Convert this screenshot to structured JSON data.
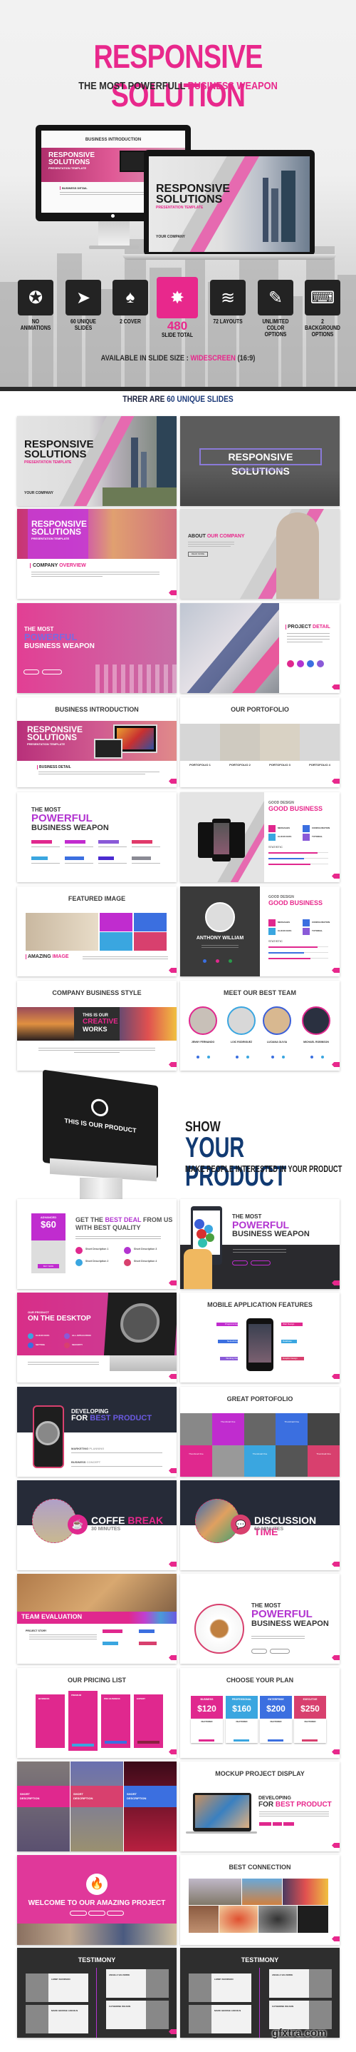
{
  "hero": {
    "title": "RESPONSIVE SOLUTION",
    "subtitle_dark": "THE MOST POWERFULL ",
    "subtitle_pink": "BUSINESS WEAPON",
    "back_monitor": {
      "heading": "BUSINESS INTRODUCTION",
      "title_line1": "RESPONSIVE",
      "title_line2": "SOLUTIONS",
      "tagline": "PRESENTATION TEMPLATE",
      "detail": "BUSINESS DETAIL"
    },
    "laptop": {
      "title_line1": "RESPONSIVE",
      "title_line2": "SOLUTIONS",
      "tagline": "PRESENTATION TEMPLATE",
      "company": "YOUR COMPANY"
    },
    "features": [
      {
        "icon": "lifebuoy-icon",
        "glyph": "✪",
        "label": "NO ANIMATIONS"
      },
      {
        "icon": "paper-plane-icon",
        "glyph": "➤",
        "label": "60 UNIQUE SLIDES"
      },
      {
        "icon": "card-icon",
        "glyph": "♠",
        "label": "2 COVER"
      },
      {
        "icon": "splash-icon",
        "glyph": "✸",
        "number": "480",
        "label": "SLIDE TOTAL",
        "active": true
      },
      {
        "icon": "layers-icon",
        "glyph": "≋",
        "label": "72 LAYOUTS"
      },
      {
        "icon": "eyedropper-icon",
        "glyph": "✎",
        "label": "UNLIMITED COLOR OPTIONS"
      },
      {
        "icon": "laptop-icon",
        "glyph": "⌨",
        "label": "2 BACKGROUND OPTIONS"
      }
    ],
    "availability_prefix": "AVAILABLE IN SLIDE  SIZE : ",
    "availability_highlight": "WIDESCREEN",
    "availability_suffix": " (16:9)"
  },
  "section_heading": {
    "prefix": "THRER ARE ",
    "highlight": "60 UNIQUE SLIDES"
  },
  "slides": {
    "s1": {
      "title1": "RESPONSIVE",
      "title2": "SOLUTIONS",
      "tagline": "PRESENTATION TEMPLATE",
      "company": "YOUR COMPANY"
    },
    "s2": {
      "title": "RESPONSIVE SOLUTIONS",
      "tagline": "PRESENTATION TEMPLATE"
    },
    "s3": {
      "title1": "RESPONSIVE",
      "title2": "SOLUTIONS",
      "tagline": "PRESENTATION TEMPLATE",
      "section_dark": "COMPANY ",
      "section_pink": "OVERVIEW"
    },
    "s4": {
      "title_dark": "ABOUT ",
      "title_pink": "OUR COMPANY",
      "button": "READ MORE"
    },
    "s5": {
      "line1": "THE MOST",
      "line2": "POWERFUL",
      "line3": "BUSINESS WEAPON"
    },
    "s6": {
      "title_dark": "PROJECT ",
      "title_pink": "DETAIL"
    },
    "s7": {
      "heading": "BUSINESS INTRODUCTION",
      "title1": "RESPONSIVE",
      "title2": "SOLUTIONS",
      "tagline": "PRESENTATION TEMPLATE",
      "detail": "BUSINESS DETAIL"
    },
    "s8": {
      "heading": "OUR PORTOFOLIO",
      "items": [
        "PORTOFOLIO 1",
        "PORTOFOLIO 2",
        "PORTOFOLIO 3",
        "PORTOFOLIO 4"
      ]
    },
    "s9": {
      "line1": "THE MOST",
      "line2": "POWERFUL",
      "line3": "BUSINESS WEAPON",
      "tags": [
        {
          "color": "#e0288e"
        },
        {
          "color": "#c22ccf"
        },
        {
          "color": "#8a5ad8"
        },
        {
          "color": "#e03a6a"
        },
        {
          "color": "#3aa6e0"
        },
        {
          "color": "#3b6fe0"
        },
        {
          "color": "#4a2bd0"
        },
        {
          "color": "#8a8a94"
        }
      ]
    },
    "s10": {
      "small": "GOOD DESIGN",
      "title": "GOOD BUSINESS",
      "features": [
        "MESSAGES",
        "CONFIGURATION",
        "CLOUD DATA",
        "TUTORIAL"
      ],
      "stats_label": "STATISTIC",
      "bars": [
        0.82,
        0.6,
        0.7
      ]
    },
    "s11": {
      "heading": "FEATURED IMAGE",
      "footer_dark": "AMAZING ",
      "footer_pink": "IMAGE"
    },
    "s12": {
      "name": "ANTHONY WILLIAM",
      "small": "GOOD DESIGN",
      "title": "GOOD BUSINESS",
      "features": [
        "MESSAGES",
        "CONFIGURATION",
        "CLOUD DATA",
        "TUTORIAL"
      ],
      "stats_label": "STATISTIC",
      "bars": [
        0.82,
        0.6,
        0.7
      ]
    },
    "s13": {
      "heading": "COMPANY BUSINESS STYLE",
      "line1": "THIS IS OUR",
      "line2": "CREATIVE",
      "line3": "WORKS"
    },
    "s14": {
      "heading": "MEET OUR BEST TEAM",
      "members": [
        "JENNY FERNANDO",
        "LOIC RODRIGUEZ",
        "LUCIANA OLIVIA",
        "MICHAEL ROBINSON"
      ],
      "ring_colors": [
        "#e0288e",
        "#3aa6e0",
        "#3b5fd8",
        "#e0288e"
      ]
    },
    "s15": {
      "plan": "ADVANCED",
      "price": "$60",
      "buy": "BUY NOW",
      "title_a": "GET THE ",
      "title_b": "BEST DEAL",
      "title_c": " FROM US",
      "title_d": "WITH BEST QUALITY",
      "descs": [
        "Short Description 1",
        "Short Description 3",
        "Short Description 2",
        "Short Description 4"
      ]
    },
    "s16": {
      "line1": "THE MOST",
      "line2": "POWERFUL",
      "line3": "BUSINESS WEAPON"
    },
    "s17": {
      "small": "OUR PRODUCT",
      "title": "ON THE DESKTOP",
      "items": [
        "CLOUD DATA",
        "ALL APPLICATION",
        "SETTING",
        "SECURITY"
      ]
    },
    "s18": {
      "heading": "MOBILE APPLICATION FEATURES",
      "left_tags": [
        "Programming",
        "Networking",
        "Working Out"
      ],
      "right_tags": [
        "Web Design",
        "Database",
        "Graphic Design"
      ]
    },
    "s19": {
      "line1": "DEVELOPING",
      "line2_dark": "FOR ",
      "line2_color": "BEST PRODUCT",
      "sec1_dark": "MARKETING ",
      "sec1_light": "PLANNING",
      "sec2_dark": "BUSINESS ",
      "sec2_light": "CONCEPT"
    },
    "s20": {
      "heading": "GREAT PORTOFOLIO",
      "tile_label": "Thumbnail One"
    },
    "s21": {
      "title_dark": "COFFE ",
      "title_pink": "BREAK",
      "duration": "30 MINUTES"
    },
    "s22": {
      "title_dark": "DISCUSSION ",
      "title_pink": "TIME",
      "duration": "60 MINUTES"
    },
    "s23": {
      "title": "TEAM EVALUATION",
      "sub": "PROJECT STORY"
    },
    "s24": {
      "line1": "THE MOST",
      "line2": "POWERFUL",
      "line3": "BUSINESS WEAPON"
    },
    "s25": {
      "heading": "OUR PRICING LIST",
      "plans": [
        "BUSINESS",
        "PREMIUM",
        "PRO BUSINESS",
        "EXPERT"
      ]
    },
    "s26": {
      "heading": "CHOOSE YOUR PLAN",
      "plans": [
        {
          "name": "BUSINESS",
          "price": "$120",
          "color": "#e0288e"
        },
        {
          "name": "PROFESSIONAL",
          "price": "$160",
          "color": "#3aa6e0"
        },
        {
          "name": "ENTERPRISE",
          "price": "$200",
          "color": "#3b6fe0"
        },
        {
          "name": "EXECUTIVE",
          "price": "$250",
          "color": "#d8406e"
        }
      ],
      "feature_label": "FEATURED"
    },
    "s27": {
      "label1": "SHORT",
      "label2": "DESCRIPTION"
    },
    "s28": {
      "heading": "MOCKUP PROJECT DISPLAY",
      "line1": "DEVELOPING",
      "line2_dark": "FOR ",
      "line2_pink": "BEST PRODUCT"
    },
    "s29": {
      "title": "WELCOME TO OUR AMAZING PROJECT"
    },
    "s30": {
      "heading": "BEST CONNECTION"
    },
    "s31": {
      "heading": "TESTIMONY",
      "people": [
        "LENNY DAVIDSON",
        "ANGELA VALVERDE",
        "MARK GEORGE LINCOLN",
        "CATHERINE WILSON"
      ]
    },
    "s32": {
      "heading": "TESTIMONY",
      "people": [
        "LENNY DAVIDSON",
        "ANGELA VALVERDE",
        "MARK GEORGE LINCOLN",
        "CATHERINE WILSON"
      ]
    }
  },
  "product": {
    "screen_title": "THIS IS OUR PRODUCT",
    "line1": "SHOW",
    "line2": "YOUR PRODUCT",
    "line3": "MAKE PEOPLE INTERESTED IN YOUR PRODUCT"
  },
  "watermark": "gfxtra.com",
  "colors": {
    "brand_pink": "#e8288c",
    "navy": "#113a72",
    "dark": "#232323"
  }
}
